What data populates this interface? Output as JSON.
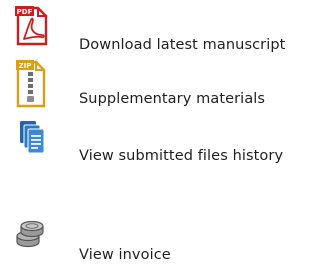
{
  "links": [
    {
      "label": "Download latest manuscript",
      "icon": "pdf-file-icon",
      "icon_text": "PDF",
      "accent": "#c8201e"
    },
    {
      "label": "Supplementary materials",
      "icon": "zip-archive-icon",
      "icon_text": "ZIP",
      "accent": "#d9a017"
    },
    {
      "label": "View submitted files history",
      "icon": "file-stack-icon",
      "accent": "#1f66b0"
    },
    {
      "label": "View invoice",
      "icon": "coin-stack-icon",
      "accent": "#8a8a8a"
    }
  ]
}
